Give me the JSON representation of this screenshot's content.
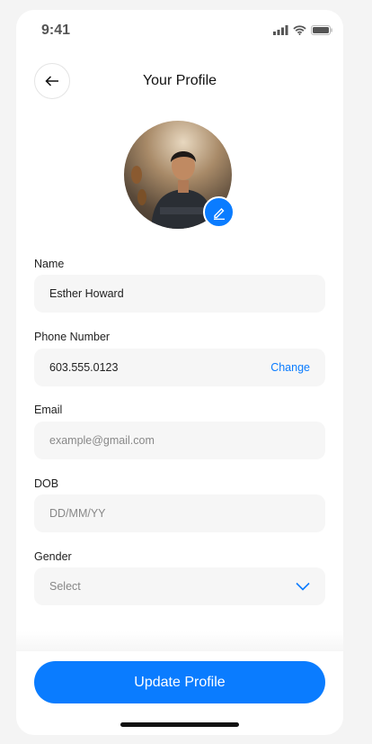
{
  "status_bar": {
    "time": "9:41"
  },
  "header": {
    "title": "Your Profile"
  },
  "form": {
    "name": {
      "label": "Name",
      "value": "Esther Howard"
    },
    "phone": {
      "label": "Phone Number",
      "value": "603.555.0123",
      "action": "Change"
    },
    "email": {
      "label": "Email",
      "placeholder": "example@gmail.com"
    },
    "dob": {
      "label": "DOB",
      "placeholder": "DD/MM/YY"
    },
    "gender": {
      "label": "Gender",
      "selected": "Select"
    }
  },
  "submit_label": "Update Profile",
  "colors": {
    "accent": "#0a7cff",
    "field_bg": "#f6f6f6"
  }
}
